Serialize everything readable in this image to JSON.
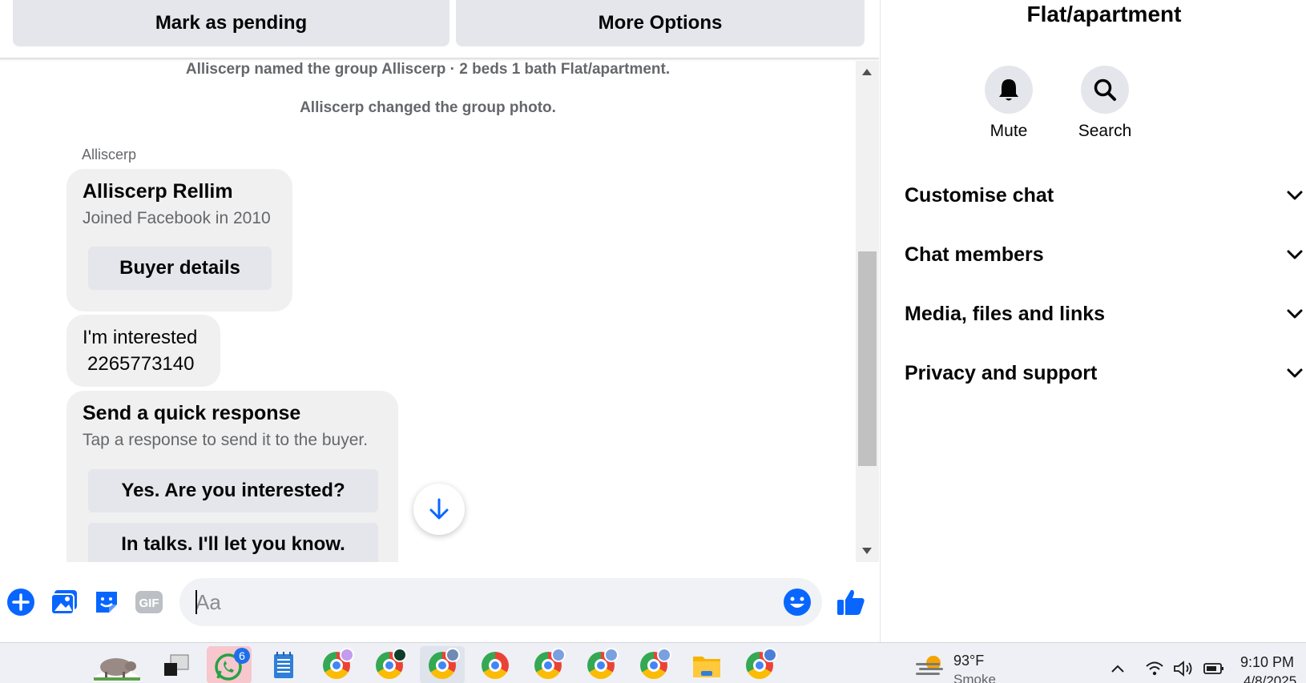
{
  "toolbar": {
    "mark_pending_label": "Mark as pending",
    "more_options_label": "More Options"
  },
  "messages": {
    "system": [
      "Alliscerp named the group Alliscerp · 2 beds 1 bath Flat/apartment.",
      "Alliscerp changed the group photo."
    ],
    "sender_name": "Alliscerp",
    "profile_card": {
      "name": "Alliscerp Rellim",
      "subtitle": "Joined Facebook in 2010",
      "button_label": "Buyer details"
    },
    "interest": {
      "line1": "I'm interested",
      "line2": "2265773140"
    },
    "quick_response": {
      "title": "Send a quick response",
      "subtitle": "Tap a response to send it to the buyer.",
      "options": [
        "Yes. Are you interested?",
        "In talks. I'll let you know."
      ]
    }
  },
  "composer": {
    "placeholder": "Aa",
    "icons": [
      "plus-icon",
      "photo-icon",
      "sticker-icon",
      "gif-icon",
      "emoji-icon",
      "thumbs-up-icon"
    ],
    "gif_label": "GIF"
  },
  "info_panel": {
    "title": "Flat/apartment",
    "actions": [
      {
        "label": "Mute",
        "icon": "bell-icon"
      },
      {
        "label": "Search",
        "icon": "search-icon"
      }
    ],
    "sections": [
      "Customise chat",
      "Chat members",
      "Media, files and links",
      "Privacy and support"
    ]
  },
  "taskbar": {
    "whatsapp_badge": "6",
    "weather_temp": "93°F",
    "weather_desc": "Smoke",
    "time": "9:10 PM",
    "date": "4/8/2025"
  },
  "colors": {
    "accent": "#0866ff",
    "bubble": "#f0f0f0",
    "button": "#e4e6eb",
    "muted_text": "#65676b"
  }
}
